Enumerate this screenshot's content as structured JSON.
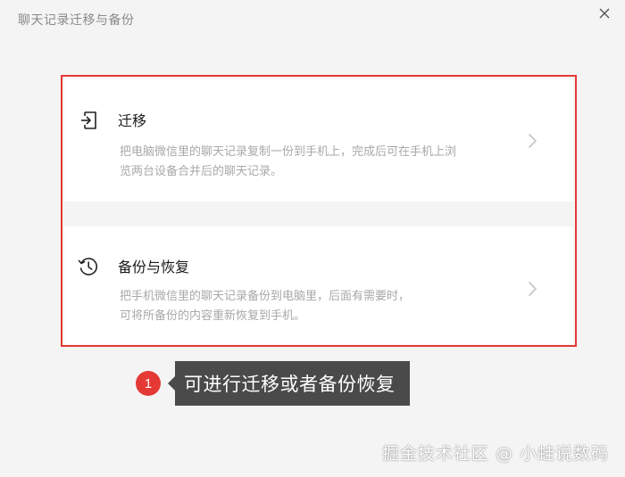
{
  "window": {
    "title": "聊天记录迁移与备份"
  },
  "options": [
    {
      "title": "迁移",
      "description_line1": "把电脑微信里的聊天记录复制一份到手机上，完成后可在手机上浏",
      "description_line2": "览两台设备合并后的聊天记录。",
      "icon": "export-icon"
    },
    {
      "title": "备份与恢复",
      "description_line1": "把手机微信里的聊天记录备份到电脑里，后面有需要时，",
      "description_line2": "可将所备份的内容重新恢复到手机。",
      "icon": "history-clock-icon"
    }
  ],
  "annotation": {
    "badge": "1",
    "text": "可进行迁移或者备份恢复"
  },
  "watermark": "掘金技术社区 @ 小蛙说数码",
  "colors": {
    "highlight_border": "#e53935",
    "badge": "#e53935",
    "callout_bg": "#4a4a4a"
  }
}
